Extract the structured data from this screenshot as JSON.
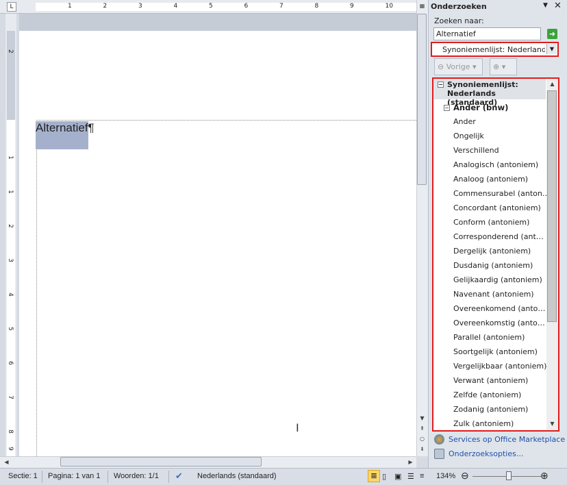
{
  "document": {
    "text": "Alternatief",
    "pilcrow": "¶"
  },
  "ruler": {
    "top_labels": [
      "1",
      "2",
      "3",
      "4",
      "5",
      "6",
      "7",
      "8",
      "9",
      "10"
    ],
    "left_labels": [
      "2",
      "1",
      "1",
      "2",
      "3",
      "4",
      "5",
      "6",
      "7",
      "8",
      "9"
    ]
  },
  "pane": {
    "title": "Onderzoeken",
    "search_label": "Zoeken naar:",
    "search_value": "Alternatief",
    "source": "Synoniemenlijst: Nederlands (standaard)",
    "back_label": "Vorige",
    "results_header": "Synoniemenlijst: Nederlands (standaard)",
    "group": "Ander (bnw)",
    "items": [
      "Ander",
      "Ongelijk",
      "Verschillend",
      "Analogisch (antoniem)",
      "Analoog (antoniem)",
      "Commensurabel (anton…",
      "Concordant (antoniem)",
      "Conform (antoniem)",
      "Corresponderend (ant…",
      "Dergelijk (antoniem)",
      "Dusdanig (antoniem)",
      "Gelijkaardig (antoniem)",
      "Navenant (antoniem)",
      "Overeenkomend (anto…",
      "Overeenkomstig (anto…",
      "Parallel (antoniem)",
      "Soortgelijk (antoniem)",
      "Vergelijkbaar (antoniem)",
      "Verwant (antoniem)",
      "Zelfde (antoniem)",
      "Zodanig (antoniem)",
      "Zulk (antoniem)"
    ],
    "links": [
      "Services op Office Marketplace",
      "Onderzoeksopties..."
    ]
  },
  "status": {
    "section": "Sectie: 1",
    "page": "Pagina: 1 van 1",
    "words": "Woorden: 1/1",
    "language": "Nederlands (standaard)",
    "zoom": "134%",
    "zoom_level_percent": 134
  },
  "colors": {
    "highlight": "#e01c1c",
    "selection": "#a5b1cc",
    "link": "#1f4fa8"
  }
}
